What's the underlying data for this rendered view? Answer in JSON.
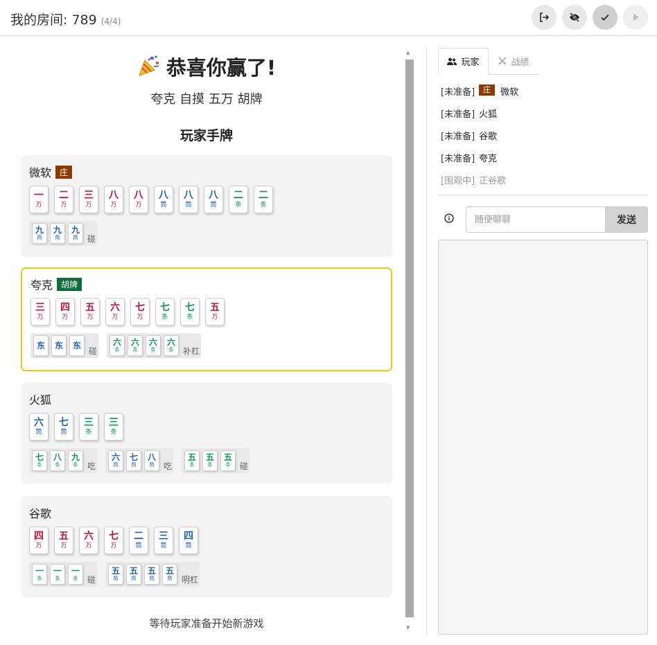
{
  "header": {
    "room_label": "我的房间: 789",
    "room_count": "(4/4)"
  },
  "result": {
    "title": "恭喜你赢了!",
    "detail": "夸克 自摸 五万 胡牌",
    "hands_title": "玩家手牌",
    "waiting_text": "等待玩家准备开始新游戏"
  },
  "players": [
    {
      "name": "微软",
      "tag": "庄",
      "tag_type": "dealer",
      "highlight": false,
      "hand": [
        {
          "n": "一",
          "s": "万",
          "t": "wan"
        },
        {
          "n": "二",
          "s": "万",
          "t": "wan"
        },
        {
          "n": "三",
          "s": "万",
          "t": "wan"
        },
        {
          "n": "八",
          "s": "万",
          "t": "wan"
        },
        {
          "n": "八",
          "s": "万",
          "t": "wan"
        },
        {
          "n": "八",
          "s": "筒",
          "t": "tong"
        },
        {
          "n": "八",
          "s": "筒",
          "t": "tong"
        },
        {
          "n": "八",
          "s": "筒",
          "t": "tong"
        },
        {
          "n": "二",
          "s": "条",
          "t": "tiao"
        },
        {
          "n": "二",
          "s": "条",
          "t": "tiao"
        }
      ],
      "melds": [
        {
          "label": "碰",
          "tiles": [
            {
              "n": "九",
              "s": "筒",
              "t": "tong"
            },
            {
              "n": "九",
              "s": "筒",
              "t": "tong"
            },
            {
              "n": "九",
              "s": "筒",
              "t": "tong"
            }
          ]
        }
      ]
    },
    {
      "name": "夸克",
      "tag": "胡牌",
      "tag_type": "hu",
      "highlight": true,
      "hand": [
        {
          "n": "三",
          "s": "万",
          "t": "wan"
        },
        {
          "n": "四",
          "s": "万",
          "t": "wan"
        },
        {
          "n": "五",
          "s": "万",
          "t": "wan"
        },
        {
          "n": "六",
          "s": "万",
          "t": "wan"
        },
        {
          "n": "七",
          "s": "万",
          "t": "wan"
        },
        {
          "n": "七",
          "s": "条",
          "t": "tiao"
        },
        {
          "n": "七",
          "s": "条",
          "t": "tiao"
        },
        {
          "n": "五",
          "s": "万",
          "t": "wan"
        }
      ],
      "melds": [
        {
          "label": "碰",
          "tiles": [
            {
              "n": "东",
              "s": "",
              "t": "zi"
            },
            {
              "n": "东",
              "s": "",
              "t": "zi"
            },
            {
              "n": "东",
              "s": "",
              "t": "zi"
            }
          ]
        },
        {
          "label": "补杠",
          "tiles": [
            {
              "n": "六",
              "s": "条",
              "t": "tiao"
            },
            {
              "n": "六",
              "s": "条",
              "t": "tiao"
            },
            {
              "n": "六",
              "s": "条",
              "t": "tiao"
            },
            {
              "n": "六",
              "s": "条",
              "t": "tiao"
            }
          ]
        }
      ]
    },
    {
      "name": "火狐",
      "tag": "",
      "tag_type": "",
      "highlight": false,
      "hand": [
        {
          "n": "六",
          "s": "筒",
          "t": "tong"
        },
        {
          "n": "七",
          "s": "筒",
          "t": "tong"
        },
        {
          "n": "三",
          "s": "条",
          "t": "tiao"
        },
        {
          "n": "三",
          "s": "条",
          "t": "tiao"
        }
      ],
      "melds": [
        {
          "label": "吃",
          "tiles": [
            {
              "n": "七",
              "s": "条",
              "t": "tiao"
            },
            {
              "n": "八",
              "s": "条",
              "t": "tiao"
            },
            {
              "n": "九",
              "s": "条",
              "t": "tiao"
            }
          ]
        },
        {
          "label": "吃",
          "tiles": [
            {
              "n": "六",
              "s": "筒",
              "t": "tong"
            },
            {
              "n": "七",
              "s": "筒",
              "t": "tong"
            },
            {
              "n": "八",
              "s": "筒",
              "t": "tong"
            }
          ]
        },
        {
          "label": "碰",
          "tiles": [
            {
              "n": "五",
              "s": "条",
              "t": "tiao"
            },
            {
              "n": "五",
              "s": "条",
              "t": "tiao"
            },
            {
              "n": "五",
              "s": "条",
              "t": "tiao"
            }
          ]
        }
      ]
    },
    {
      "name": "谷歌",
      "tag": "",
      "tag_type": "",
      "highlight": false,
      "hand": [
        {
          "n": "四",
          "s": "万",
          "t": "wan"
        },
        {
          "n": "五",
          "s": "万",
          "t": "wan"
        },
        {
          "n": "六",
          "s": "万",
          "t": "wan"
        },
        {
          "n": "七",
          "s": "万",
          "t": "wan"
        },
        {
          "n": "二",
          "s": "筒",
          "t": "tong"
        },
        {
          "n": "三",
          "s": "筒",
          "t": "tong"
        },
        {
          "n": "四",
          "s": "筒",
          "t": "tong"
        }
      ],
      "melds": [
        {
          "label": "碰",
          "tiles": [
            {
              "n": "一",
              "s": "条",
              "t": "tiao"
            },
            {
              "n": "一",
              "s": "条",
              "t": "tiao"
            },
            {
              "n": "一",
              "s": "条",
              "t": "tiao"
            }
          ]
        },
        {
          "label": "明杠",
          "tiles": [
            {
              "n": "五",
              "s": "筒",
              "t": "tong"
            },
            {
              "n": "五",
              "s": "筒",
              "t": "tong"
            },
            {
              "n": "五",
              "s": "筒",
              "t": "tong"
            },
            {
              "n": "五",
              "s": "筒",
              "t": "tong"
            }
          ]
        }
      ]
    }
  ],
  "sidebar": {
    "tab_players": "玩家",
    "tab_records": "战绩",
    "list": [
      {
        "status": "[未准备]",
        "tag": "庄",
        "name": "微软",
        "spectator": false
      },
      {
        "status": "[未准备]",
        "tag": "",
        "name": "火狐",
        "spectator": false
      },
      {
        "status": "[未准备]",
        "tag": "",
        "name": "谷歌",
        "spectator": false
      },
      {
        "status": "[未准备]",
        "tag": "",
        "name": "夸克",
        "spectator": false
      },
      {
        "status": "[围观中]",
        "tag": "",
        "name": "正谷歌",
        "spectator": true
      }
    ],
    "chat_placeholder": "随便聊聊",
    "send_label": "发送"
  },
  "icons": {
    "leave": "exit-icon",
    "hide": "eye-off-icon",
    "ready": "check-icon",
    "start": "play-icon",
    "info": "info-icon"
  }
}
